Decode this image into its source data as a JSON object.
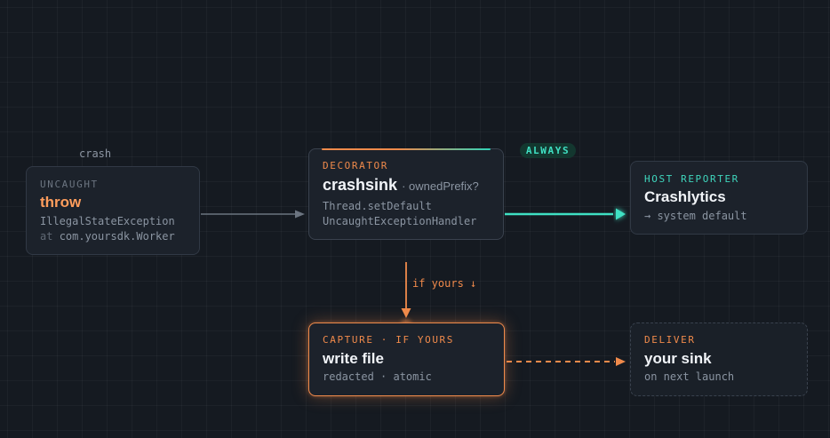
{
  "edges": {
    "crash_label": "crash",
    "always_label": "ALWAYS",
    "if_yours_label": "if yours ↓"
  },
  "nodes": {
    "uncaught": {
      "eyebrow": "UNCAUGHT",
      "title": "throw",
      "line1": "IllegalStateException",
      "line2_prefix": "at",
      "line2_value": "com.yoursdk.Worker"
    },
    "decorator": {
      "eyebrow": "DECORATOR",
      "title": "crashsink",
      "hint": "· ownedPrefix?",
      "line1": "Thread.setDefault",
      "line2": "UncaughtExceptionHandler"
    },
    "host": {
      "eyebrow": "HOST REPORTER",
      "title": "Crashlytics",
      "line1": "→ system default"
    },
    "capture": {
      "eyebrow": "CAPTURE · IF YOURS",
      "title": "write file",
      "line1": "redacted · atomic"
    },
    "deliver": {
      "eyebrow": "DELIVER",
      "title": "your sink",
      "line1": "on next launch"
    }
  },
  "colors": {
    "background": "#151a21",
    "orange": "#f08a4b",
    "teal": "#3fe0c3",
    "neutral_edge": "#6b7480"
  }
}
